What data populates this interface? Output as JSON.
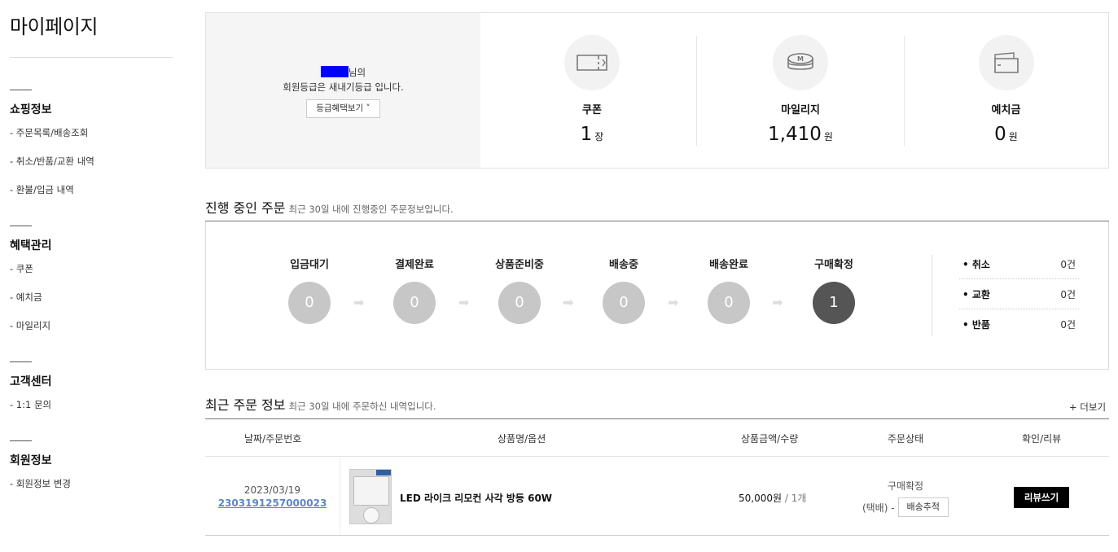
{
  "sidebar": {
    "title": "마이페이지",
    "groups": [
      {
        "heading": "쇼핑정보",
        "items": [
          "- 주문목록/배송조회",
          "- 취소/반품/교환 내역",
          "- 환불/입금 내역"
        ]
      },
      {
        "heading": "혜택관리",
        "items": [
          "- 쿠폰",
          "- 예치금",
          "- 마일리지"
        ]
      },
      {
        "heading": "고객센터",
        "items": [
          "- 1:1 문의"
        ]
      },
      {
        "heading": "회원정보",
        "items": [
          "- 회원정보 변경"
        ]
      }
    ]
  },
  "member": {
    "name_suffix": "님의",
    "grade_text": "회원등급은 새내기등급 입니다.",
    "benefit_button": "등급혜택보기"
  },
  "stats": [
    {
      "label": "쿠폰",
      "value": "1",
      "unit": "장",
      "icon": "coupon-icon"
    },
    {
      "label": "마일리지",
      "value": "1,410",
      "unit": "원",
      "icon": "mileage-icon"
    },
    {
      "label": "예치금",
      "value": "0",
      "unit": "원",
      "icon": "wallet-icon"
    }
  ],
  "progress": {
    "title": "진행 중인 주문",
    "subtitle": "최근 30일 내에 진행중인 주문정보입니다.",
    "steps": [
      {
        "label": "입금대기",
        "count": "0"
      },
      {
        "label": "결제완료",
        "count": "0"
      },
      {
        "label": "상품준비중",
        "count": "0"
      },
      {
        "label": "배송중",
        "count": "0"
      },
      {
        "label": "배송완료",
        "count": "0"
      },
      {
        "label": "구매확정",
        "count": "1"
      }
    ],
    "etc": [
      {
        "label": "• 취소",
        "value": "0건"
      },
      {
        "label": "• 교환",
        "value": "0건"
      },
      {
        "label": "• 반품",
        "value": "0건"
      }
    ]
  },
  "orders": {
    "title": "최근 주문 정보",
    "subtitle": "최근 30일 내에 주문하신 내역입니다.",
    "more": "+ 더보기",
    "columns": [
      "날짜/주문번호",
      "상품명/옵션",
      "상품금액/수량",
      "주문상태",
      "확인/리뷰"
    ],
    "rows": [
      {
        "date": "2023/03/19",
        "order_no": "2303191257000023",
        "product": "LED 라이크 리모컨 사각 방등 60W",
        "price": "50,000원",
        "qty": "/ 1개",
        "status": "구매확정",
        "carrier": "(택배) -",
        "track_button": "배송추적",
        "review_button": "리뷰쓰기"
      }
    ]
  },
  "colors": {
    "link": "#5a87c9",
    "step_done": "#555555",
    "step_pending": "#c7c7c7",
    "name_mask": "#0000ff"
  }
}
